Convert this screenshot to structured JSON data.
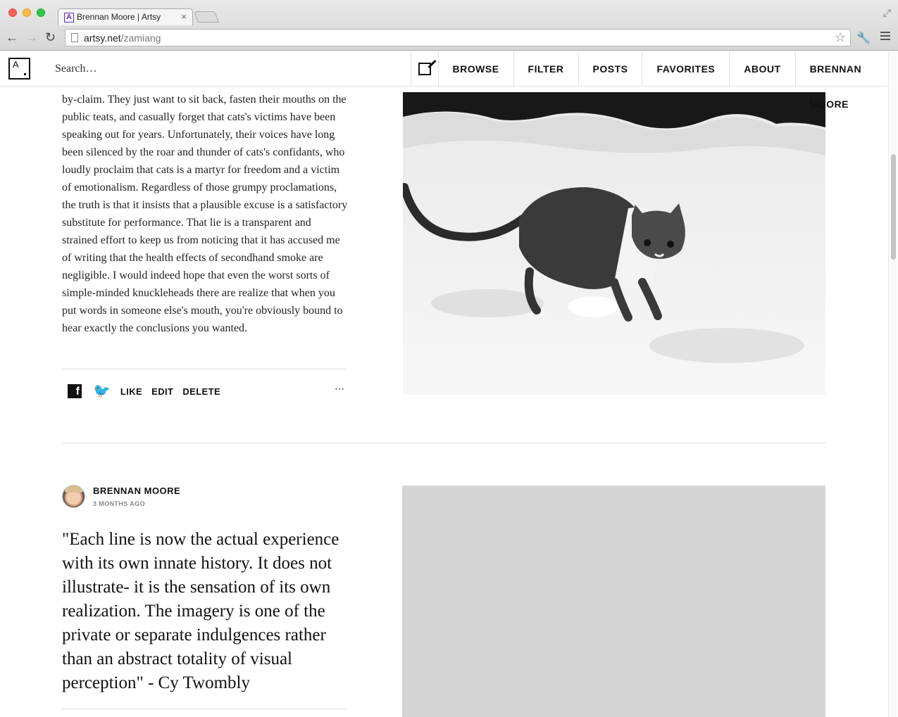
{
  "browser": {
    "tab_title": "Brennan Moore | Artsy",
    "favicon_letter": "A",
    "url_host": "artsy.net",
    "url_path": "/zamiang",
    "tab_close": "×"
  },
  "header": {
    "logo_text": "A",
    "search_placeholder": "Search…",
    "nav": {
      "browse": "BROWSE",
      "filter": "FILTER",
      "posts": "POSTS",
      "favorites": "FAVORITES",
      "about": "ABOUT",
      "user": "BRENNAN MOORE"
    }
  },
  "post1": {
    "text": "by-claim. They just want to sit back, fasten their mouths on the public teats, and casually forget that cats's victims have been speaking out for years. Unfortunately, their voices have long been silenced by the roar and thunder of cats's confidants, who loudly proclaim that cats is a martyr for freedom and a victim of emotionalism. Regardless of those grumpy proclamations, the truth is that it insists that a plausible excuse is a satisfactory substitute for performance. That lie is a transparent and strained effort to keep us from noticing that it has accused me of writing that the health effects of secondhand smoke are negligible. I would indeed hope that even the worst sorts of simple-minded knuckleheads there are realize that when you put words in someone else's mouth, you're obviously bound to hear exactly the conclusions you wanted.",
    "actions": {
      "facebook_glyph": "f",
      "twitter_glyph": "🐦",
      "like": "LIKE",
      "edit": "EDIT",
      "delete": "DELETE",
      "more_glyph": "⋯"
    }
  },
  "post2": {
    "author": "BRENNAN MOORE",
    "time": "3 MONTHS AGO",
    "quote": "\"Each line is now the actual experience with its own innate history. It does not illustrate- it is the sensation of its own realization. The imagery is one of the private or separate indulgences rather than an abstract totality of visual perception\" - Cy Twombly"
  },
  "icons": [
    "compose-icon",
    "facebook-icon",
    "twitter-icon",
    "more-icon",
    "star-icon",
    "wrench-icon",
    "menu-icon"
  ]
}
